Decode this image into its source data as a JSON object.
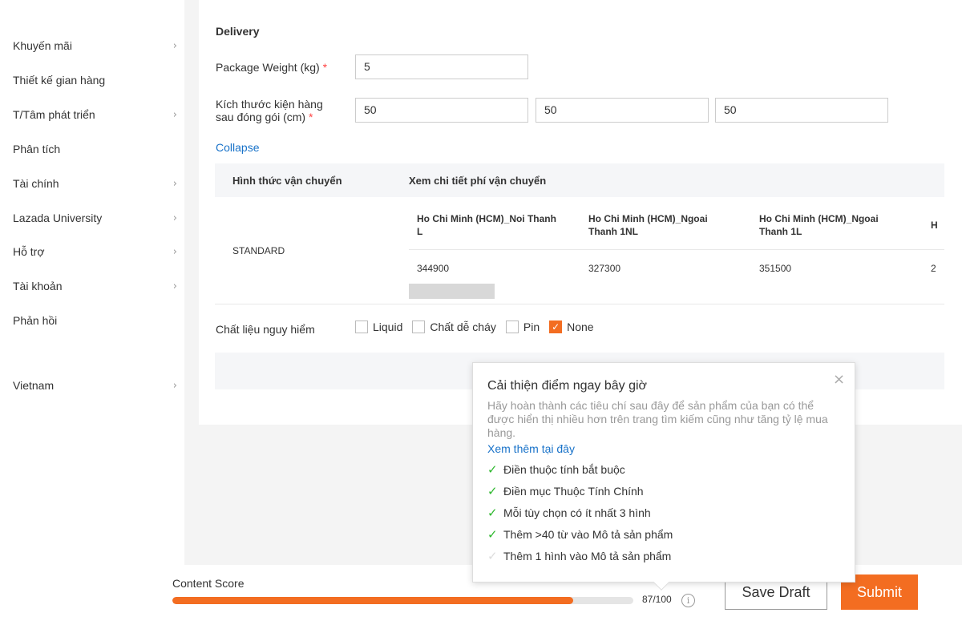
{
  "sidebar": {
    "items": [
      {
        "label": "Khuyến mãi",
        "chevron": true
      },
      {
        "label": "Thiết kế gian hàng",
        "chevron": false
      },
      {
        "label": "T/Tâm phát triển",
        "chevron": true
      },
      {
        "label": "Phân tích",
        "chevron": false
      },
      {
        "label": "Tài chính",
        "chevron": true
      },
      {
        "label": "Lazada University",
        "chevron": true
      },
      {
        "label": "Hỗ trợ",
        "chevron": true
      },
      {
        "label": "Tài khoản",
        "chevron": true
      },
      {
        "label": "Phản hồi",
        "chevron": false
      }
    ],
    "country": "Vietnam"
  },
  "delivery": {
    "section_title": "Delivery",
    "weight_label": "Package Weight (kg)",
    "weight_value": "5",
    "dims_label_1": "Kích thước kiện hàng",
    "dims_label_2": "sau đóng gói (cm)",
    "required_mark": "*",
    "length": "50",
    "width": "50",
    "height": "50",
    "collapse_link": "Collapse"
  },
  "shipping": {
    "header_method": "Hình thức vận chuyển",
    "header_fee": "Xem chi tiết phí vận chuyển",
    "method": "STANDARD",
    "zones": [
      {
        "name_1": "Ho Chi Minh (HCM)_Noi Thanh",
        "name_2": "L",
        "fee": "344900"
      },
      {
        "name_1": "Ho Chi Minh (HCM)_Ngoai",
        "name_2": "Thanh 1NL",
        "fee": "327300"
      },
      {
        "name_1": "Ho Chi Minh (HCM)_Ngoai",
        "name_2": "Thanh 1L",
        "fee": "351500"
      },
      {
        "name_1": "H",
        "name_2": "",
        "fee": "2"
      }
    ]
  },
  "hazard": {
    "label": "Chất liệu nguy hiểm",
    "options": [
      {
        "label": "Liquid",
        "checked": false
      },
      {
        "label": "Chất dễ cháy",
        "checked": false
      },
      {
        "label": "Pin",
        "checked": false
      },
      {
        "label": "None",
        "checked": true
      }
    ]
  },
  "footer": {
    "content_score_label": "Content Score",
    "score_text": "87/100",
    "score_value": 87,
    "score_max": 100,
    "save_draft": "Save Draft",
    "submit": "Submit"
  },
  "popover": {
    "title": "Cải thiện điểm ngay bây giờ",
    "description": "Hãy hoàn thành các tiêu chí sau đây để sản phẩm của bạn có thể được hiển thị nhiều hơn trên trang tìm kiếm cũng như tăng tỷ lệ mua hàng.",
    "link": "Xem thêm tại đây",
    "criteria": [
      {
        "label": "Điền thuộc tính bắt buộc",
        "done": true
      },
      {
        "label": "Điền mục Thuộc Tính Chính",
        "done": true
      },
      {
        "label": "Mỗi tùy chọn có ít nhất 3 hình",
        "done": true
      },
      {
        "label": "Thêm >40 từ vào Mô tả sản phẩm",
        "done": true
      },
      {
        "label": "Thêm 1 hình vào Mô tả sản phẩm",
        "done": false
      }
    ]
  },
  "colors": {
    "accent": "#f36d21",
    "link": "#1a73c9",
    "check": "#2eb82e"
  }
}
